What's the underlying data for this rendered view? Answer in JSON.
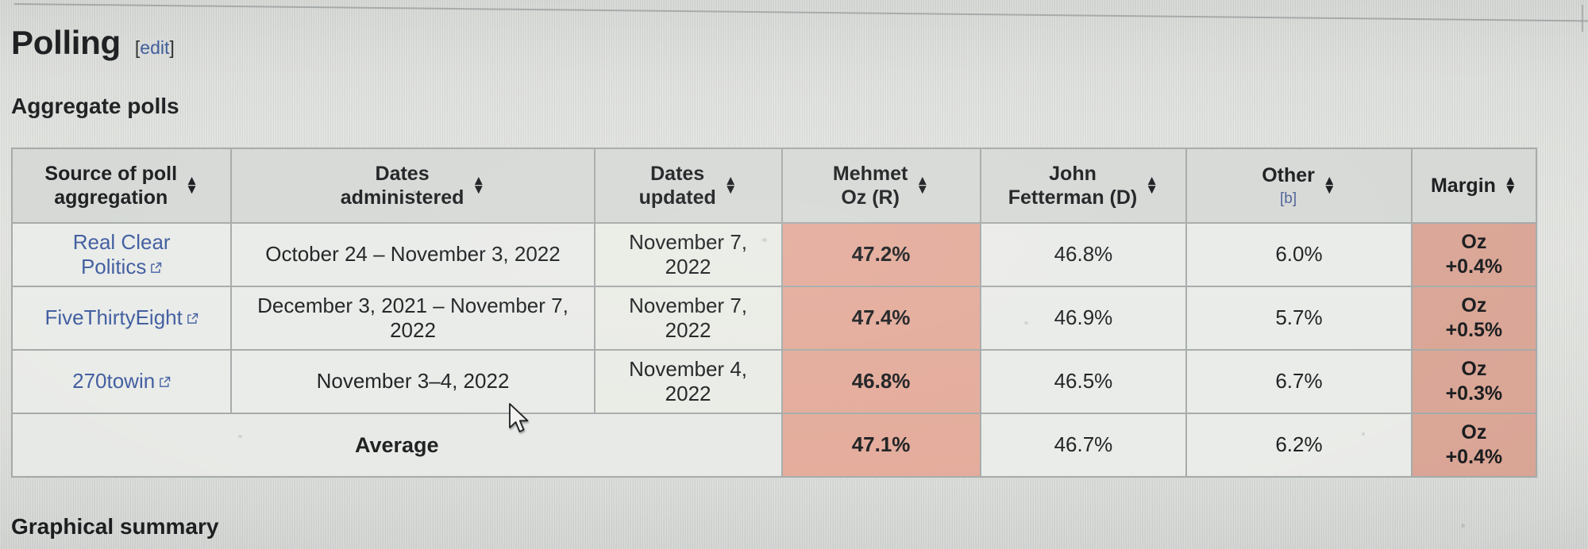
{
  "page": {
    "section_title": "Polling",
    "edit_label": "edit",
    "edit_open_bracket": "[",
    "edit_close_bracket": "]",
    "subsection_title": "Aggregate polls",
    "next_subsection_title": "Graphical summary"
  },
  "table": {
    "columns": [
      {
        "label": "Source of poll\naggregation",
        "line1": "Source of poll",
        "line2": "aggregation",
        "sortable": true
      },
      {
        "label": "Dates administered",
        "line1": "Dates",
        "line2": "administered",
        "sortable": true
      },
      {
        "label": "Dates updated",
        "line1": "Dates",
        "line2": "updated",
        "sortable": true
      },
      {
        "label": "Mehmet Oz (R)",
        "line1": "Mehmet",
        "line2": "Oz (R)",
        "sortable": true
      },
      {
        "label": "John Fetterman (D)",
        "line1": "John",
        "line2": "Fetterman (D)",
        "sortable": true
      },
      {
        "label": "Other",
        "line1": "Other",
        "line2": "[b]",
        "footnote": "[b]",
        "sortable": true
      },
      {
        "label": "Margin",
        "line1": "Margin",
        "line2": "",
        "sortable": true
      }
    ],
    "rows": [
      {
        "source_line1": "Real Clear",
        "source_line2": "Politics",
        "source_external": true,
        "dates_administered": "October 24 – November 3, 2022",
        "dates_updated_line1": "November 7,",
        "dates_updated_line2": "2022",
        "oz": "47.2%",
        "fetterman": "46.8%",
        "other": "6.0%",
        "margin_line1": "Oz",
        "margin_line2": "+0.4%"
      },
      {
        "source_line1": "FiveThirtyEight",
        "source_line2": "",
        "source_external": true,
        "dates_administered": "December 3, 2021 – November 7, 2022",
        "dates_updated_line1": "November 7,",
        "dates_updated_line2": "2022",
        "oz": "47.4%",
        "fetterman": "46.9%",
        "other": "5.7%",
        "margin_line1": "Oz",
        "margin_line2": "+0.5%"
      },
      {
        "source_line1": "270towin",
        "source_line2": "",
        "source_external": true,
        "dates_administered": "November 3–4, 2022",
        "dates_updated_line1": "November 4,",
        "dates_updated_line2": "2022",
        "oz": "46.8%",
        "fetterman": "46.5%",
        "other": "6.7%",
        "margin_line1": "Oz",
        "margin_line2": "+0.3%"
      }
    ],
    "average_row": {
      "label": "Average",
      "oz": "47.1%",
      "fetterman": "46.7%",
      "other": "6.2%",
      "margin_line1": "Oz",
      "margin_line2": "+0.4%"
    }
  },
  "colors": {
    "oz_cell": "#e3a998",
    "margin_cell": "#d9a494",
    "header_bg": "#d5d8d5",
    "cell_bg": "#e9ebe8",
    "link": "#3b5998",
    "page_bg": "#dddfdb"
  },
  "icons": {
    "sort_up": "▲",
    "sort_down": "▼",
    "external_link": "external-link-icon",
    "cursor": "mouse-pointer-icon"
  }
}
